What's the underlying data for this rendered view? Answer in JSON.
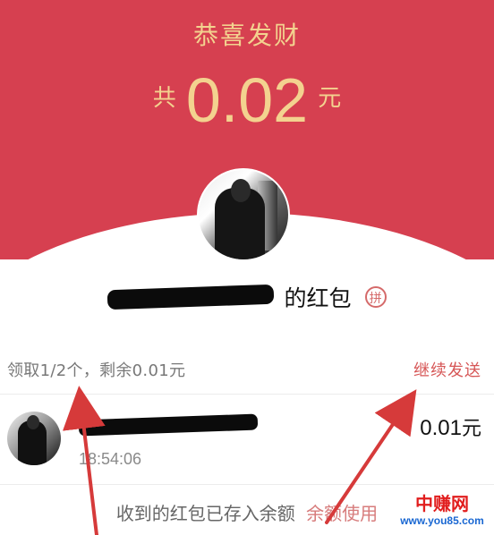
{
  "colors": {
    "header_bg": "#d64050",
    "gold_text": "#f3d28f",
    "accent_red": "#d65656",
    "muted_text": "#787878",
    "annotation_arrow": "#d63a3a",
    "watermark_red": "#e11d1d",
    "watermark_blue": "#1967d2"
  },
  "header": {
    "title": "恭喜发财",
    "amount_prefix": "共",
    "amount": "0.02",
    "amount_unit": "元"
  },
  "sender": {
    "name_visible": "的红包",
    "badge_label": "拼",
    "avatar_icon": "sender-avatar-icon"
  },
  "claim_status": {
    "summary": "领取1/2个，剩余0.01元",
    "action_label": "继续发送"
  },
  "receivers": [
    {
      "name_visible": "",
      "time": "18:54:06",
      "amount": "0.01",
      "amount_unit": "元",
      "avatar_icon": "receiver-avatar-icon"
    }
  ],
  "footer": {
    "deposited_text": "收到的红包已存入余额",
    "use_balance_label": "余额使用"
  },
  "watermark": {
    "brand": "中赚网",
    "url": "www.you85.com"
  },
  "annotation": {
    "arrows": 2
  }
}
